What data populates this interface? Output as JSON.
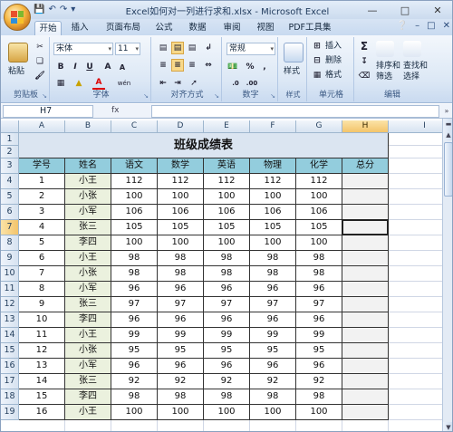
{
  "window": {
    "title": "Excel如何对一列进行求和.xlsx - Microsoft Excel",
    "qat_icons": [
      "save-icon",
      "undo-icon",
      "redo-icon",
      "customize-icon"
    ],
    "controls": [
      "minimize-icon",
      "restore-icon",
      "close-icon"
    ]
  },
  "tabs": [
    "开始",
    "插入",
    "页面布局",
    "公式",
    "数据",
    "审阅",
    "视图",
    "PDF工具集"
  ],
  "active_tab": "开始",
  "ribbon": {
    "clipboard": {
      "label": "剪贴板",
      "paste": "粘贴"
    },
    "font": {
      "label": "字体",
      "name": "宋体",
      "size": "11",
      "bold": "B",
      "italic": "I",
      "underline": "U",
      "grow": "A",
      "shrink": "A",
      "color_a": "A",
      "phonetic": "wén"
    },
    "alignment": {
      "label": "对齐方式"
    },
    "number": {
      "label": "数字",
      "format": "常规",
      "percent": "%",
      "comma": ","
    },
    "styles": {
      "label": "样式",
      "button": "样式"
    },
    "cells": {
      "label": "单元格",
      "insert": "插入",
      "delete": "删除",
      "format": "格式"
    },
    "editing": {
      "label": "编辑",
      "sigma": "Σ",
      "sort": "排序和",
      "filter": "筛选",
      "find": "查找和",
      "select": "选择"
    }
  },
  "formula_bar": {
    "name_box": "H7",
    "fx": "fx",
    "content": ""
  },
  "columns": [
    "A",
    "B",
    "C",
    "D",
    "E",
    "F",
    "G",
    "H",
    "I"
  ],
  "active_cell": {
    "col": "H",
    "row": "7"
  },
  "rows": [
    "1",
    "2",
    "3",
    "4",
    "5",
    "6",
    "7",
    "8",
    "9",
    "10",
    "11",
    "12",
    "13",
    "14",
    "15",
    "16",
    "17",
    "18",
    "19"
  ],
  "sheet": {
    "title": "班级成绩表",
    "headers": [
      "学号",
      "姓名",
      "语文",
      "数学",
      "英语",
      "物理",
      "化学",
      "总分"
    ],
    "records": [
      [
        "1",
        "小王",
        "112",
        "112",
        "112",
        "112",
        "112",
        ""
      ],
      [
        "2",
        "小张",
        "100",
        "100",
        "100",
        "100",
        "100",
        ""
      ],
      [
        "3",
        "小军",
        "106",
        "106",
        "106",
        "106",
        "106",
        ""
      ],
      [
        "4",
        "张三",
        "105",
        "105",
        "105",
        "105",
        "105",
        ""
      ],
      [
        "5",
        "李四",
        "100",
        "100",
        "100",
        "100",
        "100",
        ""
      ],
      [
        "6",
        "小王",
        "98",
        "98",
        "98",
        "98",
        "98",
        ""
      ],
      [
        "7",
        "小张",
        "98",
        "98",
        "98",
        "98",
        "98",
        ""
      ],
      [
        "8",
        "小军",
        "96",
        "96",
        "96",
        "96",
        "96",
        ""
      ],
      [
        "9",
        "张三",
        "97",
        "97",
        "97",
        "97",
        "97",
        ""
      ],
      [
        "10",
        "李四",
        "96",
        "96",
        "96",
        "96",
        "96",
        ""
      ],
      [
        "11",
        "小王",
        "99",
        "99",
        "99",
        "99",
        "99",
        ""
      ],
      [
        "12",
        "小张",
        "95",
        "95",
        "95",
        "95",
        "95",
        ""
      ],
      [
        "13",
        "小军",
        "96",
        "96",
        "96",
        "96",
        "96",
        ""
      ],
      [
        "14",
        "张三",
        "92",
        "92",
        "92",
        "92",
        "92",
        ""
      ],
      [
        "15",
        "李四",
        "98",
        "98",
        "98",
        "98",
        "98",
        ""
      ],
      [
        "16",
        "小王",
        "100",
        "100",
        "100",
        "100",
        "100",
        ""
      ]
    ]
  },
  "colors": {
    "header_fill": "#93cddd",
    "name_fill": "#ebf1de",
    "title_fill": "#dbe5f1",
    "total_fill": "#f2f2f2",
    "active_header": "#f3c46a"
  }
}
